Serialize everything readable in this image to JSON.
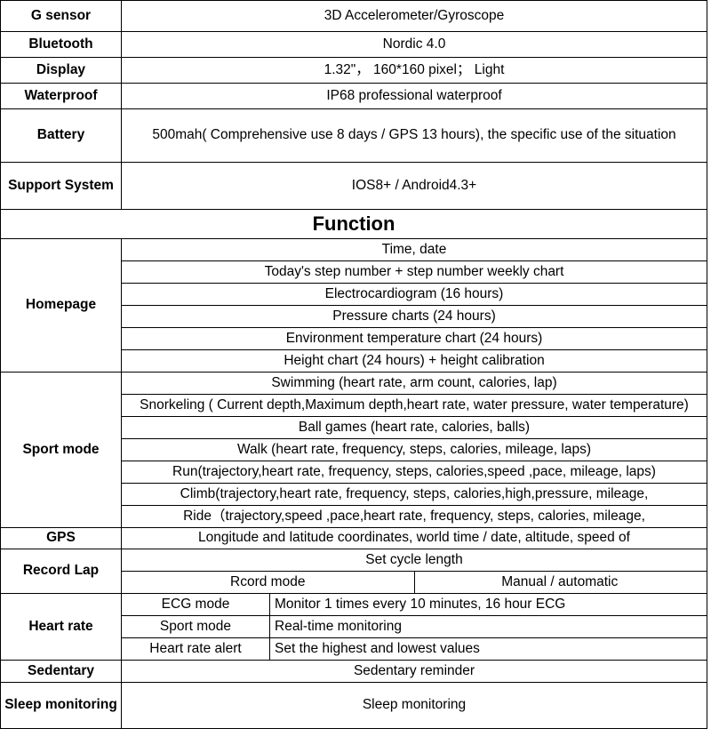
{
  "table": {
    "spec_rows": [
      {
        "label": "G sensor",
        "value": "3D Accelerometer/Gyroscope"
      },
      {
        "label": "Bluetooth",
        "value": "Nordic 4.0"
      },
      {
        "label": "Display",
        "value": "1.32\"，  160*160 pixel；  Light"
      },
      {
        "label": "Waterproof",
        "value": "IP68 professional waterproof"
      },
      {
        "label": "Battery",
        "value": "500mah( Comprehensive use 8 days / GPS 13 hours), the specific use of the situation"
      },
      {
        "label": "Support System",
        "value": "IOS8+  /  Android4.3+"
      }
    ],
    "section_title": "Function",
    "homepage": {
      "label": "Homepage",
      "items": [
        "Time, date",
        "Today's step number + step number weekly chart",
        "Electrocardiogram (16 hours)",
        "Pressure charts (24 hours)",
        "Environment temperature chart (24 hours)",
        "Height chart (24 hours) + height calibration"
      ]
    },
    "sport_mode": {
      "label": "Sport mode",
      "items": [
        "Swimming (heart rate, arm count, calories, lap)",
        "Snorkeling ( Current depth,Maximum depth,heart rate, water pressure, water temperature)",
        "Ball games (heart rate, calories, balls)",
        "Walk (heart rate, frequency, steps, calories, mileage, laps)",
        "Run(trajectory,heart rate, frequency, steps, calories,speed ,pace, mileage, laps)",
        "Climb(trajectory,heart rate, frequency, steps, calories,high,pressure, mileage,",
        "Ride（trajectory,speed ,pace,heart rate, frequency, steps, calories, mileage,"
      ]
    },
    "gps": {
      "label": "GPS",
      "value": "Longitude and latitude coordinates, world time / date, altitude, speed of"
    },
    "record_lap": {
      "label": "Record Lap",
      "full_row": "Set cycle length",
      "sub_rows": [
        {
          "name": "Rcord mode",
          "value": "Manual / automatic"
        }
      ]
    },
    "heart_rate": {
      "label": "Heart rate",
      "sub_rows": [
        {
          "name": "ECG mode",
          "value": "Monitor 1 times every 10 minutes, 16 hour ECG"
        },
        {
          "name": "Sport mode",
          "value": "Real-time monitoring"
        },
        {
          "name": "Heart rate alert",
          "value": "Set the highest and lowest values"
        }
      ]
    },
    "sedentary": {
      "label": "Sedentary",
      "value": "Sedentary reminder"
    },
    "sleep": {
      "label": "Sleep monitoring",
      "value": "Sleep monitoring"
    }
  }
}
